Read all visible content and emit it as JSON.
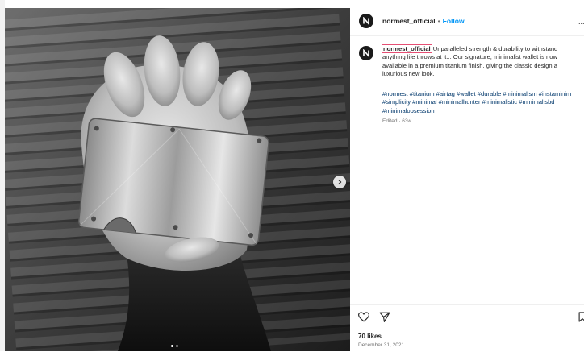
{
  "post": {
    "username": "normest_official",
    "separator": "•",
    "follow_label": "Follow",
    "more_label": "...",
    "caption_text": "Unparalleled strength & durability to withstand anything life throws at it... Our signature, minimalist wallet is now available in a premium titanium finish, giving the classic design a luxurious new look.",
    "hashtags": "#normest #titanium #airtag #wallet #durable #minimalism #instaminim #simplicity #minimal #minimalhunter #minimalistic #minimalisbd #minimalobsession",
    "edited": "Edited · 63w",
    "likes": "70 likes",
    "date": "December 31, 2021"
  },
  "carousel": {
    "slide_count": 2,
    "active_index": 0
  },
  "icons": {
    "avatar": "normest-logo-icon",
    "like": "heart-icon",
    "share": "send-icon",
    "save": "bookmark-icon",
    "next": "chevron-right-icon"
  },
  "colors": {
    "accent": "#0095f6",
    "hashtag": "#00376b",
    "muted": "#737373",
    "highlight": "#e64f74"
  }
}
